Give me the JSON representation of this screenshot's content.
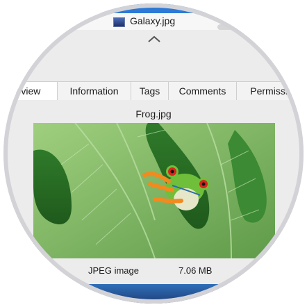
{
  "finder": {
    "top_fragment": "JPG",
    "file_name": "Galaxy.jpg"
  },
  "info": {
    "tabs": [
      {
        "label": "eview"
      },
      {
        "label": "Information"
      },
      {
        "label": "Tags"
      },
      {
        "label": "Comments"
      },
      {
        "label": "Permissio"
      }
    ],
    "active_tab_index": 0,
    "image_title": "Frog.jpg",
    "image_type": "JPEG image",
    "image_size": "7.06 MB"
  },
  "icons": {
    "collapse": "chevron-up-icon",
    "file": "image-file-icon"
  },
  "colors": {
    "accent": "#2c7ad6",
    "panel": "#ececec"
  }
}
